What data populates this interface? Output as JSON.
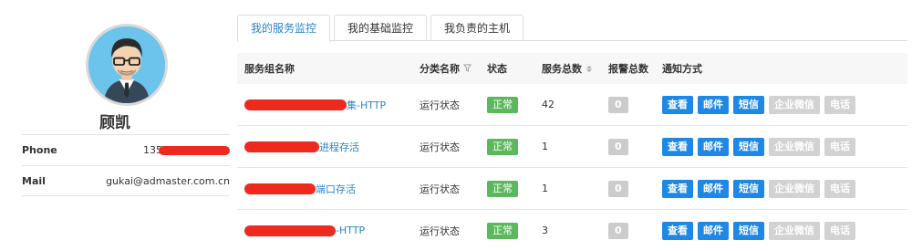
{
  "profile": {
    "name": "顾凯",
    "phone_label": "Phone",
    "phone_value": "135",
    "mail_label": "Mail",
    "mail_value": "gukai@admaster.com.cn"
  },
  "tabs": [
    {
      "label": "我的服务监控",
      "active": true
    },
    {
      "label": "我的基础监控",
      "active": false
    },
    {
      "label": "我负责的主机",
      "active": false
    }
  ],
  "table": {
    "headers": {
      "name": "服务组名称",
      "category": "分类名称",
      "status": "状态",
      "total": "服务总数",
      "alarms": "报警总数",
      "notify": "通知方式"
    },
    "rows": [
      {
        "name_suffix": "集-HTTP",
        "category": "运行状态",
        "status": "正常",
        "total": "42",
        "alarms": "0"
      },
      {
        "name_suffix": "进程存活",
        "category": "运行状态",
        "status": "正常",
        "total": "1",
        "alarms": "0"
      },
      {
        "name_suffix": "端口存活",
        "category": "运行状态",
        "status": "正常",
        "total": "1",
        "alarms": "0"
      },
      {
        "name_suffix": "-HTTP",
        "category": "运行状态",
        "status": "正常",
        "total": "3",
        "alarms": "0"
      }
    ],
    "actions": {
      "view": "查看",
      "email": "邮件",
      "sms": "短信",
      "wechat": "企业微信",
      "phone": "电话"
    }
  },
  "colors": {
    "accent": "#2a86c8",
    "button_blue": "#1e88e5",
    "status_green": "#5cb85c",
    "disabled_grey": "#d2d2d2",
    "redaction": "#ee2a1f"
  }
}
